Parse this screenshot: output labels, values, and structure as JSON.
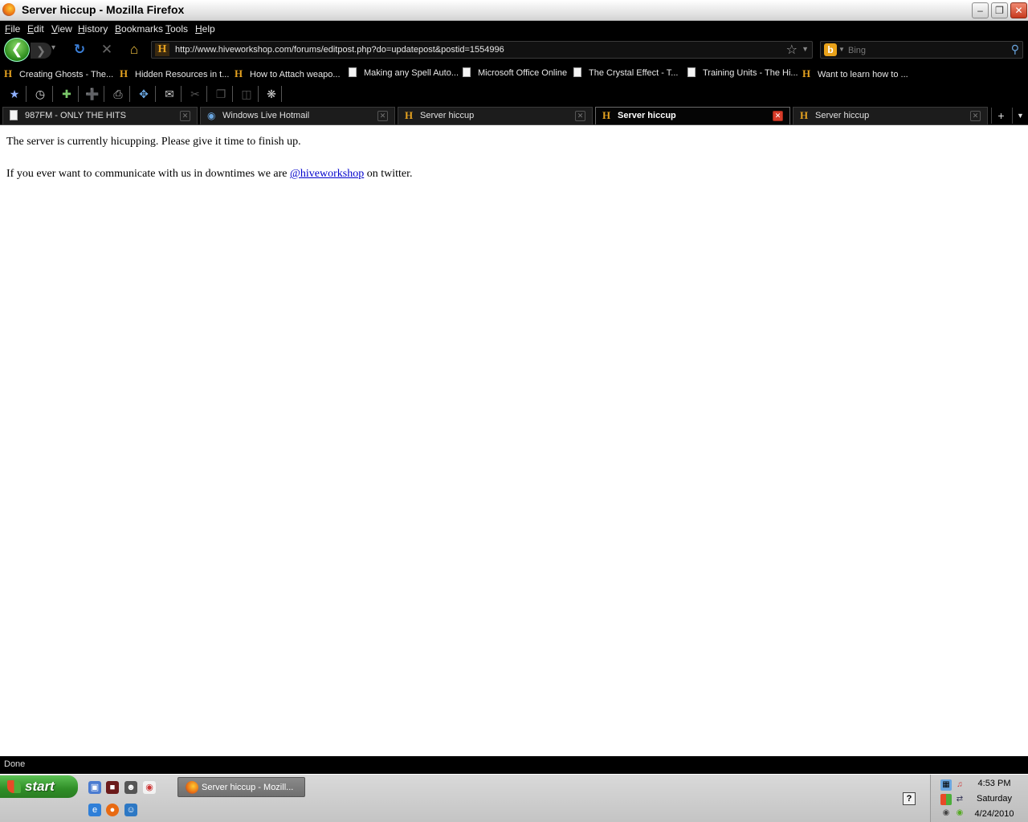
{
  "window": {
    "title": "Server hiccup - Mozilla Firefox",
    "controls": {
      "minimize": "–",
      "restore": "❐",
      "close": "✕"
    }
  },
  "menu": [
    "File",
    "Edit",
    "View",
    "History",
    "Bookmarks",
    "Tools",
    "Help"
  ],
  "navbar": {
    "url": "http://www.hiveworkshop.com/forums/editpost.php?do=updatepost&postid=1554996",
    "search_placeholder": "Bing",
    "site_icon_letter": "H"
  },
  "bookmarks": [
    {
      "label": "Creating Ghosts - The...",
      "icon": "hive-icon"
    },
    {
      "label": "Hidden Resources in t...",
      "icon": "hive-icon"
    },
    {
      "label": "How to Attach weapo...",
      "icon": "hive-icon"
    },
    {
      "label": "Making any Spell Auto...",
      "icon": "page-icon"
    },
    {
      "label": "Microsoft Office Online",
      "icon": "page-icon"
    },
    {
      "label": "The Crystal Effect - T...",
      "icon": "page-icon"
    },
    {
      "label": "Training Units - The Hi...",
      "icon": "page-icon"
    },
    {
      "label": "Want to learn how to ...",
      "icon": "hive-icon"
    }
  ],
  "tabs": [
    {
      "label": "987FM - ONLY THE HITS",
      "icon": "page-icon",
      "active": false
    },
    {
      "label": "Windows Live Hotmail",
      "icon": "hotmail-icon",
      "active": false
    },
    {
      "label": "Server hiccup",
      "icon": "hive-icon",
      "active": false
    },
    {
      "label": "Server hiccup",
      "icon": "hive-icon",
      "active": true
    },
    {
      "label": "Server hiccup",
      "icon": "hive-icon",
      "active": false
    }
  ],
  "page": {
    "line1": "The server is currently hicupping. Please give it time to finish up.",
    "line2_prefix": "If you ever want to communicate with us in downtimes we are ",
    "link_text": "@hiveworkshop",
    "line2_suffix": " on twitter."
  },
  "status": "Done",
  "taskbar": {
    "start_label": "start",
    "task_button": "Server hiccup - Mozill...",
    "help_glyph": "?",
    "clock": {
      "time": "4:53 PM",
      "day": "Saturday",
      "date": "4/24/2010"
    }
  },
  "colors": {
    "chrome_bg": "#000000",
    "link": "#0000cc",
    "start_green": "#3a9b30",
    "active_tab_close": "#d73c2a"
  }
}
